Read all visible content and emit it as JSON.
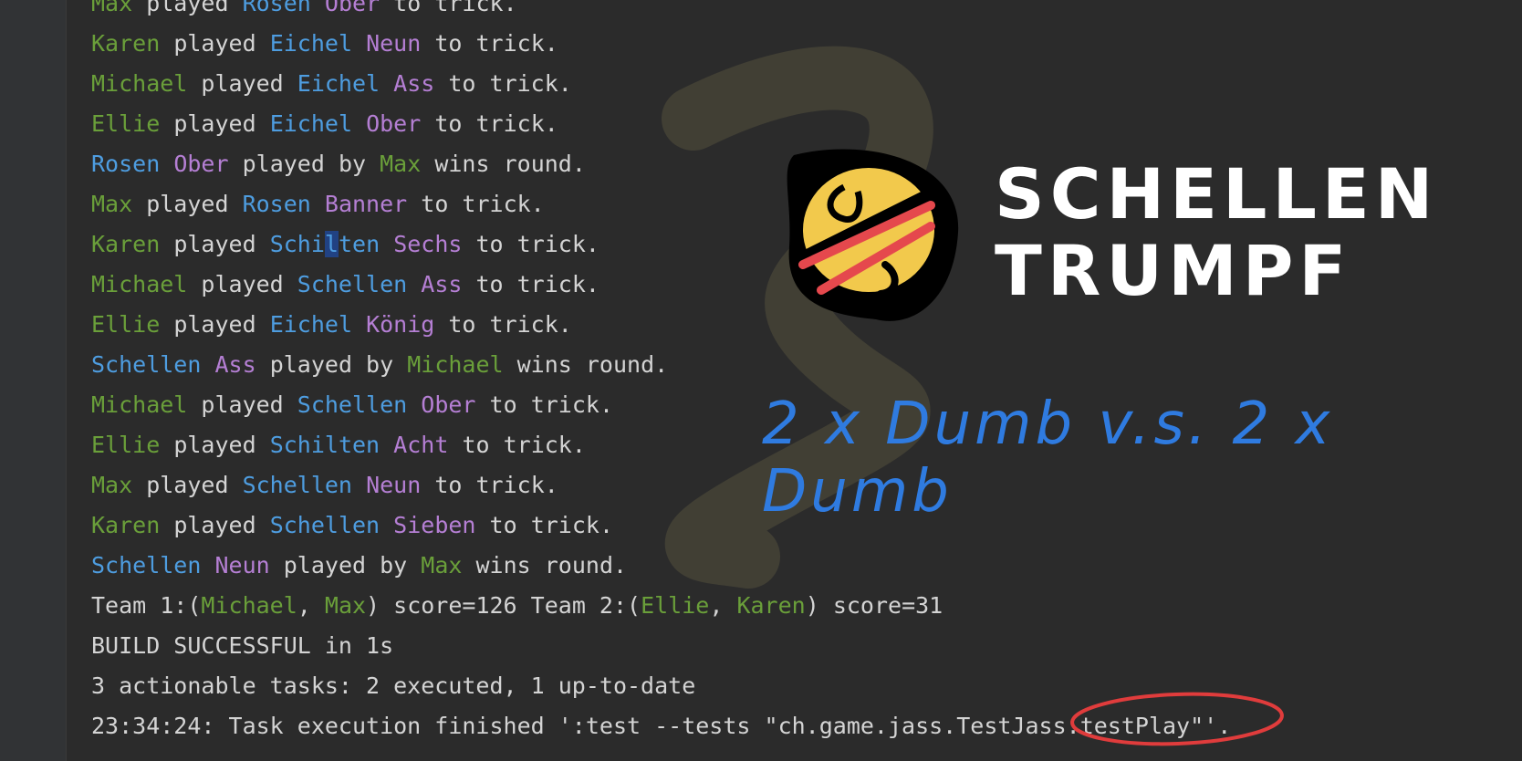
{
  "console": {
    "lines": [
      [
        {
          "t": "Max",
          "c": "pl"
        },
        {
          "t": " played "
        },
        {
          "t": "Rosen",
          "c": "suit"
        },
        {
          "t": " "
        },
        {
          "t": "Ober",
          "c": "rank"
        },
        {
          "t": " to trick."
        }
      ],
      [
        {
          "t": "Karen",
          "c": "pl"
        },
        {
          "t": " played "
        },
        {
          "t": "Eichel",
          "c": "suit"
        },
        {
          "t": " "
        },
        {
          "t": "Neun",
          "c": "rank"
        },
        {
          "t": " to trick."
        }
      ],
      [
        {
          "t": "Michael",
          "c": "pl"
        },
        {
          "t": " played "
        },
        {
          "t": "Eichel",
          "c": "suit"
        },
        {
          "t": " "
        },
        {
          "t": "Ass",
          "c": "rank"
        },
        {
          "t": " to trick."
        }
      ],
      [
        {
          "t": "Ellie",
          "c": "pl"
        },
        {
          "t": " played "
        },
        {
          "t": "Eichel",
          "c": "suit"
        },
        {
          "t": " "
        },
        {
          "t": "Ober",
          "c": "rank"
        },
        {
          "t": " to trick."
        }
      ],
      [
        {
          "t": "Rosen",
          "c": "suit"
        },
        {
          "t": " "
        },
        {
          "t": "Ober",
          "c": "rank"
        },
        {
          "t": " played by "
        },
        {
          "t": "Max",
          "c": "pl"
        },
        {
          "t": " wins round."
        }
      ],
      [
        {
          "t": "Max",
          "c": "pl"
        },
        {
          "t": " played "
        },
        {
          "t": "Rosen",
          "c": "suit"
        },
        {
          "t": " "
        },
        {
          "t": "Banner",
          "c": "rank"
        },
        {
          "t": " to trick."
        }
      ],
      [
        {
          "t": "Karen",
          "c": "pl"
        },
        {
          "t": " played "
        },
        {
          "t": "Schi",
          "c": "suit"
        },
        {
          "t": "l",
          "c": "suit cursor"
        },
        {
          "t": "ten",
          "c": "suit"
        },
        {
          "t": " "
        },
        {
          "t": "Sechs",
          "c": "rank"
        },
        {
          "t": " to trick."
        }
      ],
      [
        {
          "t": "Michael",
          "c": "pl"
        },
        {
          "t": " played "
        },
        {
          "t": "Schellen",
          "c": "suit"
        },
        {
          "t": " "
        },
        {
          "t": "Ass",
          "c": "rank"
        },
        {
          "t": " to trick."
        }
      ],
      [
        {
          "t": "Ellie",
          "c": "pl"
        },
        {
          "t": " played "
        },
        {
          "t": "Eichel",
          "c": "suit"
        },
        {
          "t": " "
        },
        {
          "t": "König",
          "c": "rank"
        },
        {
          "t": " to trick."
        }
      ],
      [
        {
          "t": "Schellen",
          "c": "suit"
        },
        {
          "t": " "
        },
        {
          "t": "Ass",
          "c": "rank"
        },
        {
          "t": " played by "
        },
        {
          "t": "Michael",
          "c": "pl"
        },
        {
          "t": " wins round."
        }
      ],
      [
        {
          "t": "Michael",
          "c": "pl"
        },
        {
          "t": " played "
        },
        {
          "t": "Schellen",
          "c": "suit"
        },
        {
          "t": " "
        },
        {
          "t": "Ober",
          "c": "rank"
        },
        {
          "t": " to trick."
        }
      ],
      [
        {
          "t": "Ellie",
          "c": "pl"
        },
        {
          "t": " played "
        },
        {
          "t": "Schilten",
          "c": "suit"
        },
        {
          "t": " "
        },
        {
          "t": "Acht",
          "c": "rank"
        },
        {
          "t": " to trick."
        }
      ],
      [
        {
          "t": "Max",
          "c": "pl"
        },
        {
          "t": " played "
        },
        {
          "t": "Schellen",
          "c": "suit"
        },
        {
          "t": " "
        },
        {
          "t": "Neun",
          "c": "rank"
        },
        {
          "t": " to trick."
        }
      ],
      [
        {
          "t": "Karen",
          "c": "pl"
        },
        {
          "t": " played "
        },
        {
          "t": "Schellen",
          "c": "suit"
        },
        {
          "t": " "
        },
        {
          "t": "Sieben",
          "c": "rank"
        },
        {
          "t": " to trick."
        }
      ],
      [
        {
          "t": "Schellen",
          "c": "suit"
        },
        {
          "t": " "
        },
        {
          "t": "Neun",
          "c": "rank"
        },
        {
          "t": " played by "
        },
        {
          "t": "Max",
          "c": "pl"
        },
        {
          "t": " wins round."
        }
      ],
      [
        {
          "t": "Team 1:("
        },
        {
          "t": "Michael",
          "c": "pl"
        },
        {
          "t": ", "
        },
        {
          "t": "Max",
          "c": "pl"
        },
        {
          "t": ") score=126 Team 2:("
        },
        {
          "t": "Ellie",
          "c": "pl"
        },
        {
          "t": ", "
        },
        {
          "t": "Karen",
          "c": "pl"
        },
        {
          "t": ") score=31"
        }
      ],
      [
        {
          "t": "BUILD SUCCESSFUL in 1s"
        }
      ],
      [
        {
          "t": "3 actionable tasks: 2 executed, 1 up-to-date"
        }
      ],
      [
        {
          "t": "23:34:24: Task execution finished ':test --tests \"ch.game.jass.TestJass.testPlay\"'."
        }
      ]
    ]
  },
  "overlay": {
    "title_line1": "SCHELLEN",
    "title_line2": "TRUMPF",
    "subtitle": "2 x Dumb v.s. 2 x Dumb",
    "logo_icon": "schellen-bell-icon",
    "colors": {
      "player": "#6a9f3a",
      "suit": "#4e9de0",
      "rank": "#b57fd4",
      "highlight_circle": "#e03c3c",
      "subtitle": "#2f7be0"
    }
  }
}
